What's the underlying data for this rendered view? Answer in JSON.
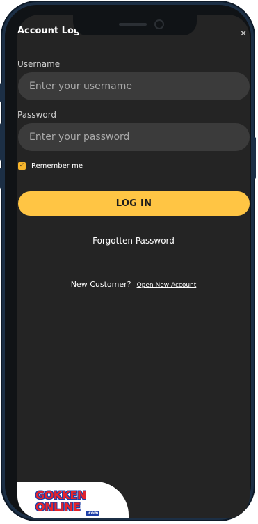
{
  "header": {
    "title": "Account Log",
    "close_icon": "close-icon"
  },
  "form": {
    "username_label": "Username",
    "username_placeholder": "Enter your username",
    "password_label": "Password",
    "password_placeholder": "Enter your password",
    "remember_label": "Remember me",
    "remember_checked": true,
    "login_label": "LOG IN"
  },
  "links": {
    "forgot": "Forgotten Password",
    "new_customer_text": "New Customer?",
    "open_account": "Open New Account"
  },
  "logo": {
    "line1": "GOKKEN",
    "line2": "ONLINE",
    "suffix": ".com"
  },
  "colors": {
    "accent": "#ffc544",
    "screen_bg": "#242424",
    "input_bg": "#3b3b3b"
  }
}
